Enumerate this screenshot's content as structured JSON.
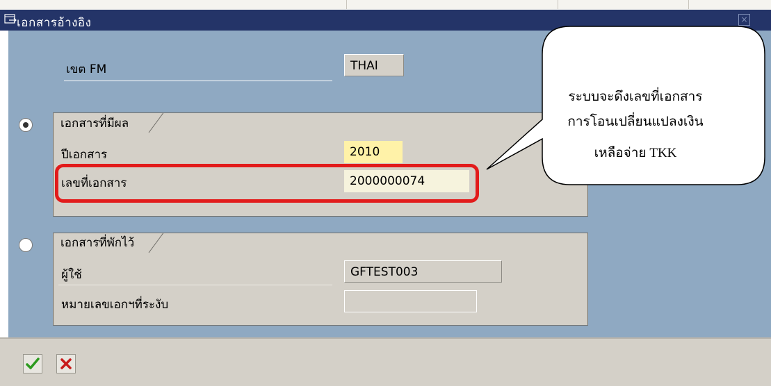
{
  "window": {
    "title": "เอกสารอ้างอิง",
    "close_symbol": "×"
  },
  "fm_area": {
    "label": "เขต FM",
    "value": "THAI"
  },
  "posted_group": {
    "title": "เอกสารที่มีผล",
    "selected": true,
    "year_label": "ปีเอกสาร",
    "year_value": "2010",
    "docno_label": "เลขที่เอกสาร",
    "docno_value": "2000000074"
  },
  "parked_group": {
    "title": "เอกสารที่พักไว้",
    "selected": false,
    "user_label": "ผู้ใช้",
    "user_value": "GFTEST003",
    "refno_label": "หมายเลขเอกฯที่ระงับ",
    "refno_value": ""
  },
  "callout": {
    "line1": "ระบบจะดึงเลขที่เอกสาร",
    "line2": "การโอนเปลี่ยนแปลงเงิน",
    "line3": "เหลือจ่าย TKK"
  },
  "buttons": {
    "ok_icon": "check-icon",
    "cancel_icon": "x-icon"
  },
  "colors": {
    "title_bar": "#243468",
    "content_bg": "#8fa9c2",
    "highlight": "#e21b1b"
  }
}
